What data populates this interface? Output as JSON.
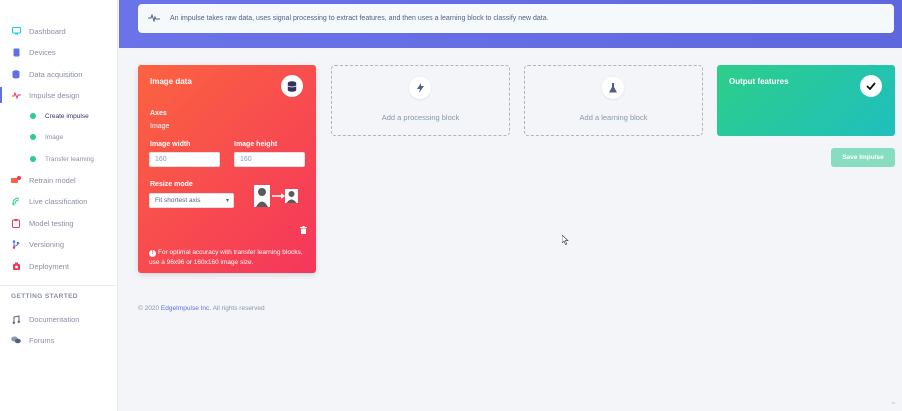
{
  "sidebar": {
    "items": [
      {
        "label": "Dashboard",
        "icon": "monitor-icon",
        "color": "#11cdef"
      },
      {
        "label": "Devices",
        "icon": "devices-icon",
        "color": "#5e72e4"
      },
      {
        "label": "Data acquisition",
        "icon": "database-icon",
        "color": "#5e72e4"
      },
      {
        "label": "Impulse design",
        "icon": "pulse-icon",
        "color": "#f5365c"
      },
      {
        "label": "Retrain model",
        "icon": "retrain-icon",
        "color": "#fb6340"
      },
      {
        "label": "Live classification",
        "icon": "live-icon",
        "color": "#2dce89"
      },
      {
        "label": "Model testing",
        "icon": "testing-icon",
        "color": "#f5365c"
      },
      {
        "label": "Versioning",
        "icon": "versioning-icon",
        "color": "#5e72e4"
      },
      {
        "label": "Deployment",
        "icon": "deployment-icon",
        "color": "#f5365c"
      }
    ],
    "subitems": [
      {
        "label": "Create impulse"
      },
      {
        "label": "Image"
      },
      {
        "label": "Transfer learning"
      }
    ],
    "section_title": "GETTING STARTED",
    "help_items": [
      {
        "label": "Documentation",
        "icon": "documentation-icon"
      },
      {
        "label": "Forums",
        "icon": "forums-icon"
      }
    ]
  },
  "header": {
    "info_text": "An impulse takes raw data, uses signal processing to extract features, and then uses a learning block to classify new data."
  },
  "image_card": {
    "title": "Image data",
    "axes_label": "Axes",
    "axes_value": "Image",
    "width_label": "Image width",
    "width_value": "160",
    "height_label": "Image height",
    "height_value": "160",
    "resize_label": "Resize mode",
    "resize_value": "Fit shortest axis",
    "note": "For optimal accuracy with transfer learning blocks, use a 96x96 or 160x160 image size.",
    "colors": {
      "start": "#fb6340",
      "end": "#f5365c"
    }
  },
  "processing_block": {
    "label": "Add a processing block",
    "icon": "bolt-icon"
  },
  "learning_block": {
    "label": "Add a learning block",
    "icon": "flask-icon"
  },
  "output_card": {
    "title": "Output features",
    "icon": "check-icon",
    "colors": {
      "start": "#2dce89",
      "end": "#1fbfbe"
    }
  },
  "save_button": {
    "label": "Save Impulse"
  },
  "footer": {
    "prefix": "© 2020",
    "link": "EdgeImpulse Inc.",
    "suffix": "All rights reserved"
  }
}
